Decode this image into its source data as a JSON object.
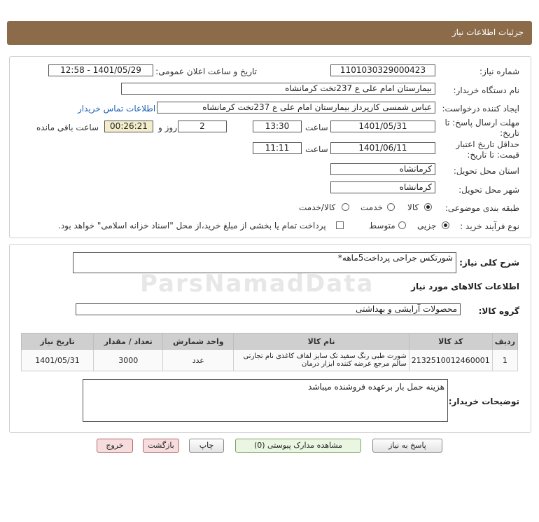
{
  "header": {
    "title": "جزئیات اطلاعات نیاز"
  },
  "watermark": "ParsNamadData",
  "form": {
    "need_number_label": "شماره نیاز:",
    "need_number": "1101030329000423",
    "announce_label": "تاریخ و ساعت اعلان عمومی:",
    "announce_value": "1401/05/29 - 12:58",
    "buyer_org_label": "نام دستگاه خریدار:",
    "buyer_org": "بیمارستان امام علی ع 237تخت کرمانشاه",
    "creator_label": "ایجاد کننده درخواست:",
    "creator": "عباس شمسی کارپرداز بیمارستان امام علی ع 237تخت کرمانشاه",
    "contact_link": "اطلاعات تماس خریدار",
    "deadline_label": "مهلت ارسال پاسخ: تا تاریخ:",
    "deadline_date": "1401/05/31",
    "time_label": "ساعت",
    "deadline_time": "13:30",
    "days_value": "2",
    "days_label": "روز و",
    "remaining_time": "00:26:21",
    "remaining_label": "ساعت باقی مانده",
    "price_validity_label": "حداقل تاریخ اعتبار قیمت: تا تاریخ:",
    "price_validity_date": "1401/06/11",
    "price_validity_time": "11:11",
    "province_label": "استان محل تحویل:",
    "province": "کرمانشاه",
    "city_label": "شهر محل تحویل:",
    "city": "کرمانشاه",
    "category_label": "طبقه بندی موضوعی:",
    "category_options": [
      "کالا",
      "خدمت",
      "کالا/خدمت"
    ],
    "process_label": "نوع فرآیند خرید :",
    "process_options": [
      "جزیی",
      "متوسط"
    ],
    "payment_note": "پرداخت تمام یا بخشی از مبلغ خرید،از محل \"اسناد خزانه اسلامی\" خواهد بود."
  },
  "summary": {
    "label": "شرح کلی نیاز:",
    "value": "شورتکس جراحی پرداخت5ماهه*"
  },
  "goods": {
    "section_title": "اطلاعات کالاهای مورد نیاز",
    "group_label": "گروه کالا:",
    "group_value": "محصولات آرایشی و بهداشتی",
    "columns": [
      "ردیف",
      "کد کالا",
      "نام کالا",
      "واحد شمارش",
      "تعداد / مقدار",
      "تاریخ نیاز"
    ],
    "rows": [
      {
        "index": "1",
        "code": "2132510012460001",
        "name": "شورت طبی رنگ سفید تک سایز لفاف کاغذی نام تجارتی سالم مرجع عرضه کننده ابزار درمان",
        "unit": "عدد",
        "qty": "3000",
        "date": "1401/05/31"
      }
    ]
  },
  "buyer_notes": {
    "label": "توضیحات خریدار:",
    "value": "هزینه  حمل بار برعهده فروشنده میباشد"
  },
  "buttons": {
    "reply": "پاسخ به نیاز",
    "docs": "مشاهده مدارک پیوستی (0)",
    "print": "چاپ",
    "back": "بازگشت",
    "exit": "خروج"
  }
}
